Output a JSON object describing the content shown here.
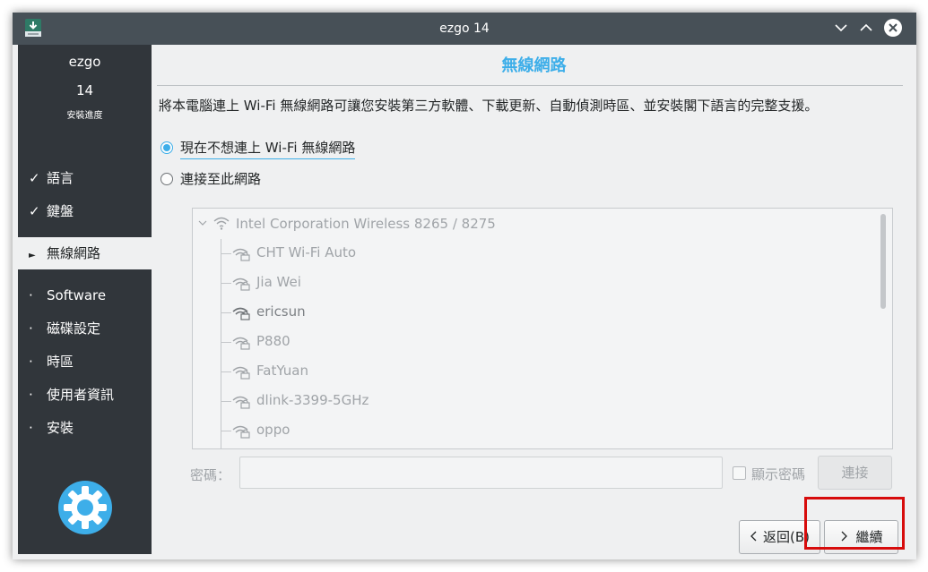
{
  "window": {
    "title": "ezgo 14"
  },
  "sidebar": {
    "name": "ezgo",
    "version": "14",
    "subtitle": "安裝進度",
    "steps": [
      {
        "mark": "✓",
        "label": "語言"
      },
      {
        "mark": "✓",
        "label": "鍵盤"
      },
      {
        "mark": "►",
        "label": "無線網路"
      },
      {
        "mark": "·",
        "label": "Software"
      },
      {
        "mark": "·",
        "label": "磁碟設定"
      },
      {
        "mark": "·",
        "label": "時區"
      },
      {
        "mark": "·",
        "label": "使用者資訊"
      },
      {
        "mark": "·",
        "label": "安裝"
      }
    ],
    "active_step": "無線網路"
  },
  "page": {
    "title": "無線網路",
    "description": "將本電腦連上 Wi-Fi 無線網路可讓您安裝第三方軟體、下載更新、自動偵測時區、並安裝閣下語言的完整支援。",
    "option_skip": "現在不想連上 Wi-Fi 無線網路",
    "option_connect": "連接至此網路",
    "selected_option": "現在不想連上 Wi-Fi 無線網路"
  },
  "networks": {
    "adapter": "Intel Corporation Wireless 8265 / 8275",
    "items": [
      "CHT Wi-Fi Auto",
      "Jia Wei",
      "ericsun",
      "P880",
      "FatYuan",
      "dlink-3399-5GHz",
      "oppo"
    ]
  },
  "password": {
    "label": "密碼：",
    "value": "",
    "show_label": "顯示密碼",
    "connect_label": "連接"
  },
  "nav": {
    "back_label": "返回(B)",
    "next_label": "繼續"
  },
  "colors": {
    "accent": "#3daee9",
    "sidebar_bg": "#31363b",
    "titlebar_bg": "#475057",
    "highlight": "#d70c0c"
  }
}
